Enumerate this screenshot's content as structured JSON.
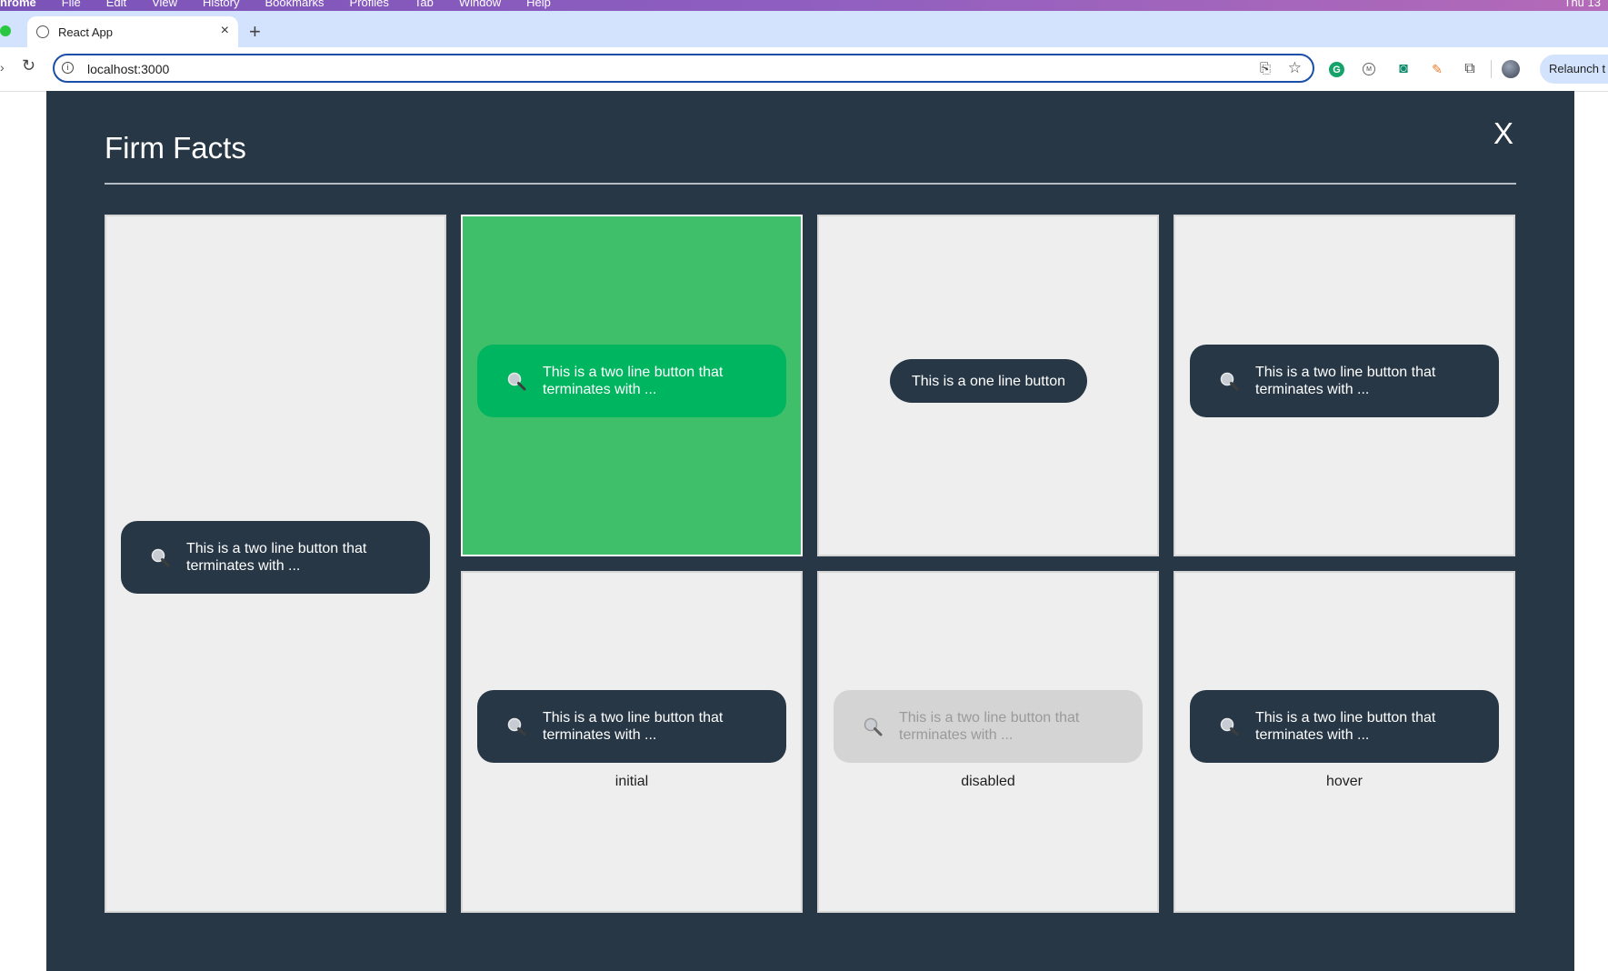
{
  "menubar": {
    "app": "hrome",
    "items": [
      "File",
      "Edit",
      "View",
      "History",
      "Bookmarks",
      "Profiles",
      "Tab",
      "Window",
      "Help"
    ],
    "clock": "Thu 13"
  },
  "browser": {
    "tab_title": "React App",
    "tab_close": "×",
    "new_tab": "+",
    "url": "localhost:3000",
    "relaunch_label": "Relaunch t"
  },
  "modal": {
    "title": "Firm Facts",
    "close_label": "X"
  },
  "cells": {
    "c1": {
      "button": "This is a two line button that terminates with ..."
    },
    "c2": {
      "button": "This is a two line button that terminates with ..."
    },
    "c3": {
      "button": "This is a one line button"
    },
    "c4": {
      "button": "This is a two line button that terminates with ..."
    },
    "c5": {
      "button": "This is a two line button that terminates with ...",
      "state": "initial"
    },
    "c6": {
      "button": "This is a two line button that terminates with ...",
      "state": "disabled"
    },
    "c7": {
      "button": "This is a two line button that terminates with ...",
      "state": "hover"
    }
  },
  "colors": {
    "modal_bg": "#273746",
    "cell_bg": "#eeeeee",
    "highlight_cell_bg": "#40bf6a",
    "green_button": "#00b55f",
    "dark_button": "#273746",
    "disabled_button": "#d4d4d4"
  },
  "icons": {
    "button_icon": "magnifier-icon",
    "close_icon": "close-icon"
  }
}
